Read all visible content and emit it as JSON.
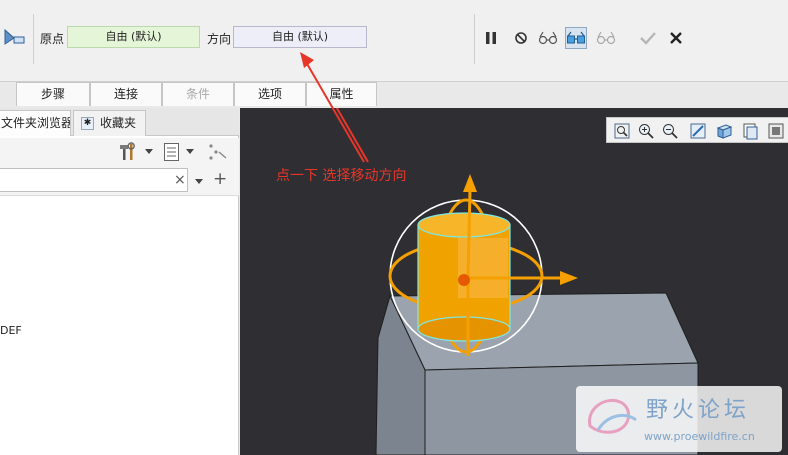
{
  "ribbon": {
    "origin_label": "原点",
    "origin_value": "自由 (默认)",
    "direction_label": "方向",
    "direction_value": "自由 (默认)"
  },
  "controls": {
    "icons": [
      "pause-icon",
      "stop-icon",
      "glasses-outline-icon",
      "glasses-preview-icon",
      "glasses-gray-icon",
      "checkmark-icon",
      "close-icon"
    ]
  },
  "tabs": [
    {
      "label": "步骤",
      "enabled": true
    },
    {
      "label": "连接",
      "enabled": true
    },
    {
      "label": "条件",
      "enabled": false
    },
    {
      "label": "选项",
      "enabled": true
    },
    {
      "label": "属性",
      "enabled": true
    }
  ],
  "panel": {
    "tab_folder": "文件夹浏览器",
    "tab_favorites": "收藏夹",
    "search_value": "",
    "tree_item": "DEF"
  },
  "annotation": {
    "callout": "点一下  选择移动方向"
  },
  "watermark": {
    "title": "野火论坛",
    "url": "www.proewildfire.cn"
  },
  "colors": {
    "accent_orange": "#f5a000",
    "callout_red": "#e8352a",
    "viewport_bg": "#2f2f33",
    "origin_field_bg": "#e4f6d7",
    "direction_field_bg": "#eeeef8"
  }
}
